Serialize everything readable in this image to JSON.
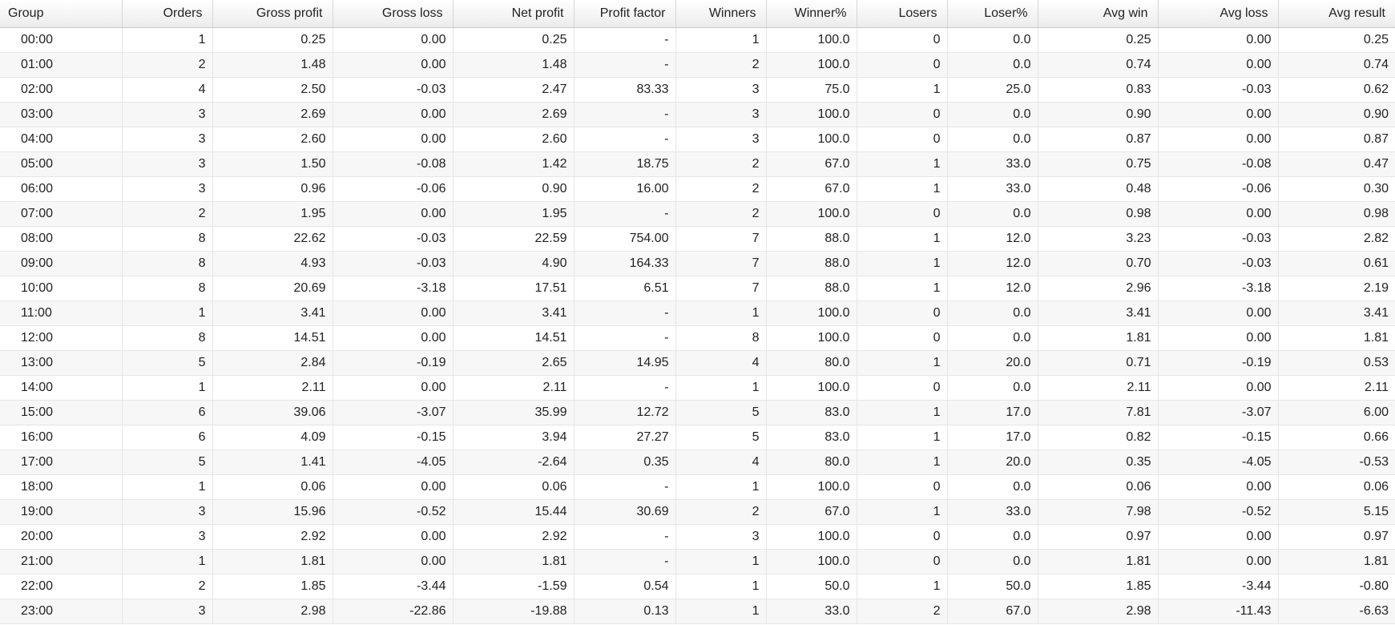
{
  "table": {
    "columns": [
      "Group",
      "Orders",
      "Gross profit",
      "Gross loss",
      "Net profit",
      "Profit factor",
      "Winners",
      "Winner%",
      "Losers",
      "Loser%",
      "Avg win",
      "Avg loss",
      "Avg result"
    ],
    "rows": [
      [
        "00:00",
        "1",
        "0.25",
        "0.00",
        "0.25",
        "-",
        "1",
        "100.0",
        "0",
        "0.0",
        "0.25",
        "0.00",
        "0.25"
      ],
      [
        "01:00",
        "2",
        "1.48",
        "0.00",
        "1.48",
        "-",
        "2",
        "100.0",
        "0",
        "0.0",
        "0.74",
        "0.00",
        "0.74"
      ],
      [
        "02:00",
        "4",
        "2.50",
        "-0.03",
        "2.47",
        "83.33",
        "3",
        "75.0",
        "1",
        "25.0",
        "0.83",
        "-0.03",
        "0.62"
      ],
      [
        "03:00",
        "3",
        "2.69",
        "0.00",
        "2.69",
        "-",
        "3",
        "100.0",
        "0",
        "0.0",
        "0.90",
        "0.00",
        "0.90"
      ],
      [
        "04:00",
        "3",
        "2.60",
        "0.00",
        "2.60",
        "-",
        "3",
        "100.0",
        "0",
        "0.0",
        "0.87",
        "0.00",
        "0.87"
      ],
      [
        "05:00",
        "3",
        "1.50",
        "-0.08",
        "1.42",
        "18.75",
        "2",
        "67.0",
        "1",
        "33.0",
        "0.75",
        "-0.08",
        "0.47"
      ],
      [
        "06:00",
        "3",
        "0.96",
        "-0.06",
        "0.90",
        "16.00",
        "2",
        "67.0",
        "1",
        "33.0",
        "0.48",
        "-0.06",
        "0.30"
      ],
      [
        "07:00",
        "2",
        "1.95",
        "0.00",
        "1.95",
        "-",
        "2",
        "100.0",
        "0",
        "0.0",
        "0.98",
        "0.00",
        "0.98"
      ],
      [
        "08:00",
        "8",
        "22.62",
        "-0.03",
        "22.59",
        "754.00",
        "7",
        "88.0",
        "1",
        "12.0",
        "3.23",
        "-0.03",
        "2.82"
      ],
      [
        "09:00",
        "8",
        "4.93",
        "-0.03",
        "4.90",
        "164.33",
        "7",
        "88.0",
        "1",
        "12.0",
        "0.70",
        "-0.03",
        "0.61"
      ],
      [
        "10:00",
        "8",
        "20.69",
        "-3.18",
        "17.51",
        "6.51",
        "7",
        "88.0",
        "1",
        "12.0",
        "2.96",
        "-3.18",
        "2.19"
      ],
      [
        "11:00",
        "1",
        "3.41",
        "0.00",
        "3.41",
        "-",
        "1",
        "100.0",
        "0",
        "0.0",
        "3.41",
        "0.00",
        "3.41"
      ],
      [
        "12:00",
        "8",
        "14.51",
        "0.00",
        "14.51",
        "-",
        "8",
        "100.0",
        "0",
        "0.0",
        "1.81",
        "0.00",
        "1.81"
      ],
      [
        "13:00",
        "5",
        "2.84",
        "-0.19",
        "2.65",
        "14.95",
        "4",
        "80.0",
        "1",
        "20.0",
        "0.71",
        "-0.19",
        "0.53"
      ],
      [
        "14:00",
        "1",
        "2.11",
        "0.00",
        "2.11",
        "-",
        "1",
        "100.0",
        "0",
        "0.0",
        "2.11",
        "0.00",
        "2.11"
      ],
      [
        "15:00",
        "6",
        "39.06",
        "-3.07",
        "35.99",
        "12.72",
        "5",
        "83.0",
        "1",
        "17.0",
        "7.81",
        "-3.07",
        "6.00"
      ],
      [
        "16:00",
        "6",
        "4.09",
        "-0.15",
        "3.94",
        "27.27",
        "5",
        "83.0",
        "1",
        "17.0",
        "0.82",
        "-0.15",
        "0.66"
      ],
      [
        "17:00",
        "5",
        "1.41",
        "-4.05",
        "-2.64",
        "0.35",
        "4",
        "80.0",
        "1",
        "20.0",
        "0.35",
        "-4.05",
        "-0.53"
      ],
      [
        "18:00",
        "1",
        "0.06",
        "0.00",
        "0.06",
        "-",
        "1",
        "100.0",
        "0",
        "0.0",
        "0.06",
        "0.00",
        "0.06"
      ],
      [
        "19:00",
        "3",
        "15.96",
        "-0.52",
        "15.44",
        "30.69",
        "2",
        "67.0",
        "1",
        "33.0",
        "7.98",
        "-0.52",
        "5.15"
      ],
      [
        "20:00",
        "3",
        "2.92",
        "0.00",
        "2.92",
        "-",
        "3",
        "100.0",
        "0",
        "0.0",
        "0.97",
        "0.00",
        "0.97"
      ],
      [
        "21:00",
        "1",
        "1.81",
        "0.00",
        "1.81",
        "-",
        "1",
        "100.0",
        "0",
        "0.0",
        "1.81",
        "0.00",
        "1.81"
      ],
      [
        "22:00",
        "2",
        "1.85",
        "-3.44",
        "-1.59",
        "0.54",
        "1",
        "50.0",
        "1",
        "50.0",
        "1.85",
        "-3.44",
        "-0.80"
      ],
      [
        "23:00",
        "3",
        "2.98",
        "-22.86",
        "-19.88",
        "0.13",
        "1",
        "33.0",
        "2",
        "67.0",
        "2.98",
        "-11.43",
        "-6.63"
      ]
    ]
  }
}
